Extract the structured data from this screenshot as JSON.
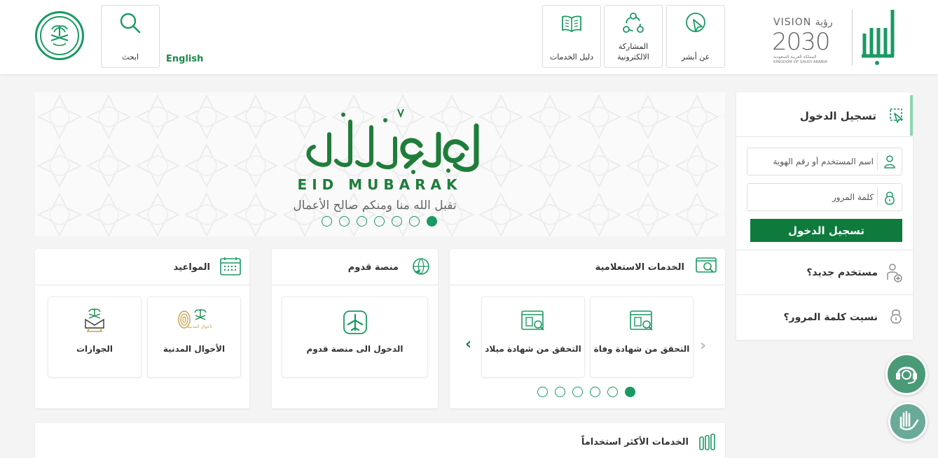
{
  "header": {
    "search_label": "ابحث",
    "language_link": "English",
    "nav": [
      {
        "label": "دليل الخدمات",
        "icon": "book-icon"
      },
      {
        "label": "المشاركة\nالالكترونية",
        "icon": "network-icon"
      },
      {
        "label": "عن أبشر",
        "icon": "cursor-icon"
      }
    ],
    "vision": {
      "brand": "VISION رؤية",
      "year": "2030",
      "sub_ar": "المملكة العربية السعودية",
      "sub_en": "KINGDOM OF SAUDI ARABIA"
    }
  },
  "banner": {
    "calligraphy": "عيدكم مبارك",
    "title_en": "EID MUBARAK",
    "subtitle": "تقبل الله منا ومنكم صالح الأعمال",
    "slide_count": 7,
    "active_slide": 7
  },
  "login": {
    "title": "تسجيل الدخول",
    "username_placeholder": "اسم المستخدم أو رقم الهوية",
    "password_placeholder": "كلمة المرور",
    "submit_label": "تسجيل الدخول",
    "new_user": "مستخدم جديد؟",
    "forgot_password": "نسيت كلمة المرور؟"
  },
  "cards": {
    "inquiry": {
      "title": "الخدمات الاستعلامية",
      "tiles": [
        "التحقق من شهادة وفاة",
        "التحقق من شهادة ميلاد"
      ],
      "slide_count": 6,
      "active_slide": 6
    },
    "qudoom": {
      "title": "منصة قدوم",
      "tiles": [
        "الدخول الى منصة قدوم"
      ]
    },
    "appointments": {
      "title": "المواعيد",
      "tiles": [
        "الأحوال المدنية",
        "الجوازات"
      ],
      "civil_logo_text": "الأحوال المدنية"
    }
  },
  "most_used": {
    "title": "الخدمات الأكثر استخداماً"
  },
  "colors": {
    "primary": "#0e7a3c",
    "accent": "#1a9a62",
    "background": "#f4f4f4"
  }
}
